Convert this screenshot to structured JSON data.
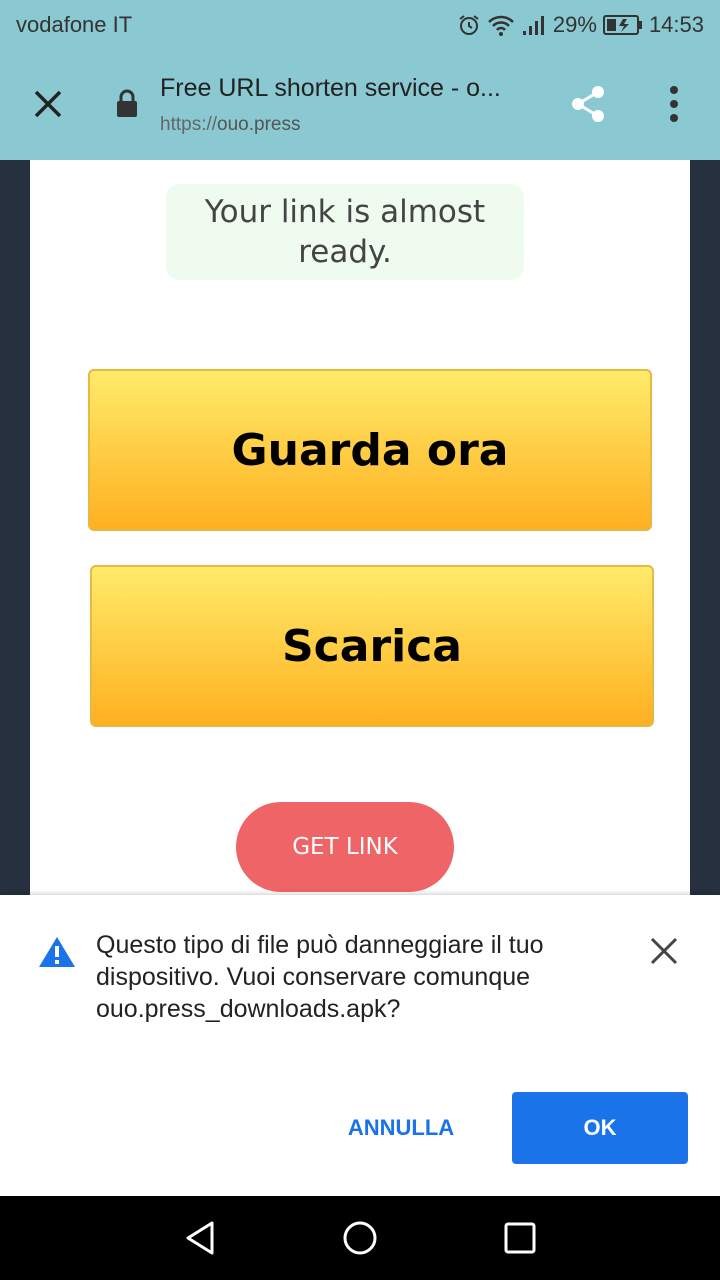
{
  "status_bar": {
    "carrier": "vodafone IT",
    "battery": "29%",
    "time": "14:53"
  },
  "toolbar": {
    "title": "Free URL shorten service - o...",
    "url_scheme": "https://",
    "url_host": "ouo.press"
  },
  "page": {
    "notice": "Your link is almost ready.",
    "primary_button": "Guarda ora",
    "secondary_button": "Scarica",
    "get_link": "GET LINK"
  },
  "download_warning": {
    "message": "Questo tipo di file può danneggiare il tuo dispositivo. Vuoi conservare comunque ouo.press_downloads.apk?",
    "cancel_label": "ANNULLA",
    "ok_label": "OK"
  },
  "colors": {
    "toolbar": "#8ac8d2",
    "cta_top": "#ffeb6a",
    "cta_bottom": "#ffb020",
    "get_link": "#ef6466",
    "accent": "#1a73e8"
  },
  "icons": [
    "alarm-icon",
    "wifi-icon",
    "signal-icon",
    "battery-icon",
    "close-icon",
    "lock-icon",
    "share-icon",
    "more-vert-icon",
    "warning-icon",
    "back-icon",
    "home-icon",
    "recents-icon"
  ]
}
